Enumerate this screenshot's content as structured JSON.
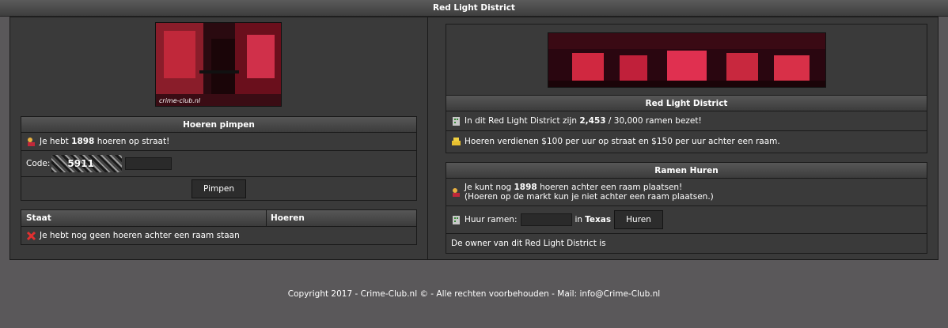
{
  "title": "Red Light District",
  "logo_text": "crime-club.nl",
  "pimp": {
    "header": "Hoeren pimpen",
    "status_prefix": "Je hebt ",
    "status_count": "1898",
    "status_suffix": " hoeren op straat!",
    "code_label": "Code:",
    "captcha": "5911",
    "button": "Pimpen"
  },
  "window_table": {
    "col_state": "Staat",
    "col_whores": "Hoeren",
    "empty_msg": "Je hebt nog geen hoeren achter een raam staan"
  },
  "district": {
    "header": "Red Light District",
    "line1_prefix": "In dit Red Light District zijn ",
    "line1_used": "2,453",
    "line1_mid": " / 30,000 ramen bezet!",
    "line2": "Hoeren verdienen $100 per uur op straat en $150 per uur achter een raam."
  },
  "rent": {
    "header": "Ramen Huren",
    "line1_prefix": "Je kunt nog ",
    "line1_count": "1898",
    "line1_suffix": " hoeren achter een raam plaatsen!",
    "line2": "(Hoeren op de markt kun je niet achter een raam plaatsen.)",
    "label": "Huur ramen:",
    "in_label": "in",
    "city": "Texas",
    "button": "Huren",
    "owner": "De owner van dit Red Light District is"
  },
  "footer": "Copyright 2017 - Crime-Club.nl © - Alle rechten voorbehouden - Mail: info@Crime-Club.nl"
}
